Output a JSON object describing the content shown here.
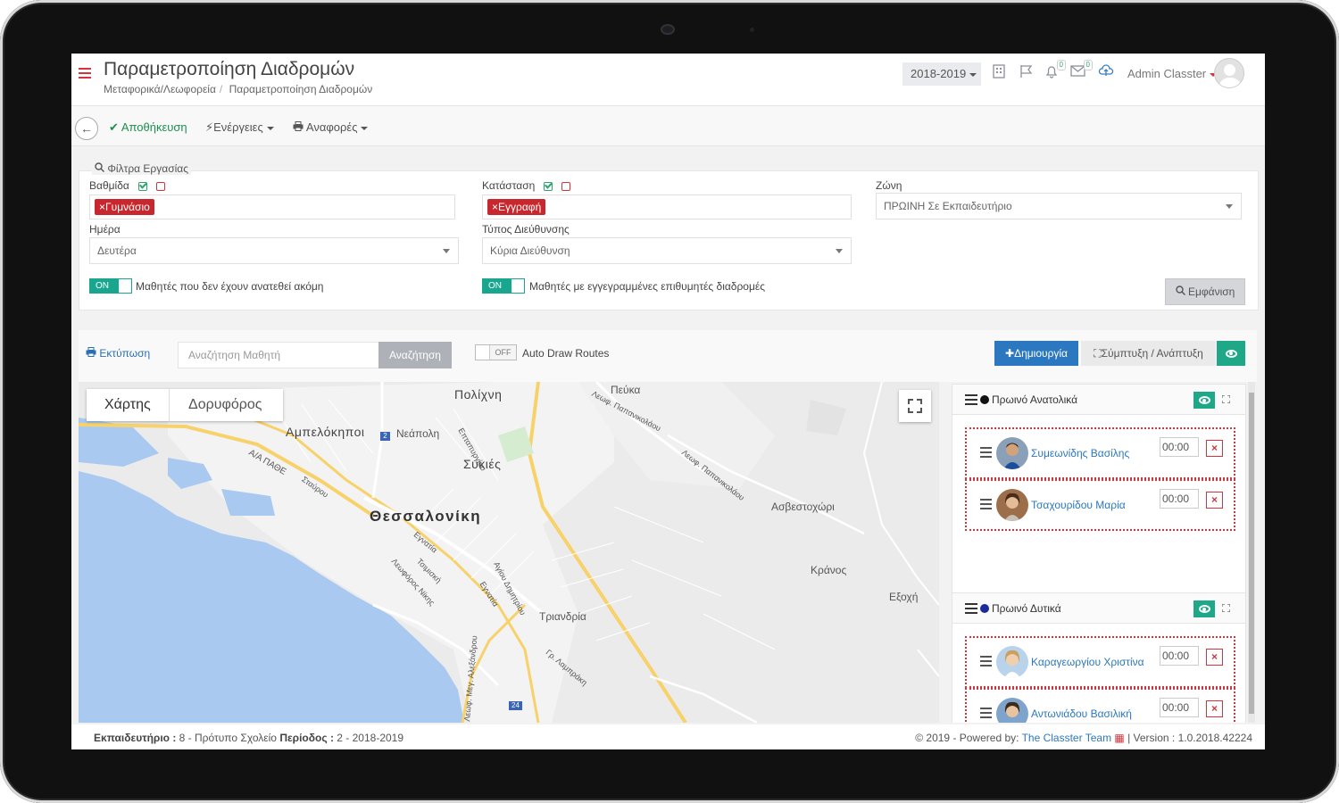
{
  "header": {
    "title": "Παραμετροποίηση Διαδρομών",
    "breadcrumb": [
      "Μεταφορικά/Λεωφορεία",
      "Παραμετροποίηση Διαδρομών"
    ],
    "year": "2018-2019",
    "notifications_count": "0",
    "messages_count": "0",
    "user": "Admin Classter"
  },
  "toolbar": {
    "save": "Αποθήκευση",
    "actions": "Ενέργειες",
    "reports": "Αναφορές"
  },
  "filters": {
    "title": "Φίλτρα Εργασίας",
    "grade_label": "Βαθμίδα",
    "grade_tag": "Γυμνάσιο",
    "status_label": "Κατάσταση",
    "status_tag": "Εγγραφή",
    "zone_label": "Ζώνη",
    "zone_value": "ΠΡΩΙΝΗ Σε Εκπαιδευτήριο",
    "day_label": "Ημέρα",
    "day_value": "Δευτέρα",
    "address_type_label": "Τύπος Διεύθυνσης",
    "address_type_value": "Κύρια Διεύθυνση",
    "toggle_on": "ON",
    "unassigned_label": "Μαθητές που δεν έχουν ανατεθεί ακόμη",
    "desired_routes_label": "Μαθητές με εγγεγραμμένες επιθυμητές διαδρομές",
    "show_button": "Εμφάνιση"
  },
  "main": {
    "print": "Εκτύπωση",
    "search_placeholder": "Αναζήτηση Μαθητή",
    "search_button": "Αναζήτηση",
    "auto_draw_toggle": "OFF",
    "auto_draw_label": "Auto Draw Routes",
    "create_button": "Δημιουργία",
    "collapse_button": "Σύμπτυξη / Ανάπτυξη"
  },
  "map": {
    "tab_map": "Χάρτης",
    "tab_satellite": "Δορυφόρος",
    "places": {
      "thessaloniki": "Θεσσαλονίκη",
      "polichni": "Πολίχνη",
      "ampelokipoi": "Αμπελόκηποι",
      "neapoli": "Νεάπολη",
      "sykies": "Συκιές",
      "pefka": "Πεύκα",
      "asvestochori": "Ασβεστοχώρι",
      "kranos": "Κράνος",
      "exochi": "Εξοχή",
      "triandria": "Τριανδρία"
    },
    "roads": {
      "papanikolaou": "Λεωφ. Παπανικολάου",
      "papanikolaou2": "Λεωφ. Παπανικολάου",
      "aa_papagou": "Α/Α ΠΑΘΕ",
      "stavrou": "Σταύρου",
      "egnatia": "Εγνατία",
      "egnatia2": "Εγνατία",
      "tsimiski": "Τσιμισκή",
      "leof_nikis": "Λεωφόρος Νίκης",
      "ag_dimitriou": "Αγίου Δημητρίου",
      "alexandrou": "Λεωφ. Μεγ. Αλεξάνδρου",
      "sheriff": "Επταπυργίου",
      "kalamaria": "Γρ. Λαμπράκη"
    },
    "road_markers": [
      "2",
      "24"
    ]
  },
  "routes": [
    {
      "name": "Πρωινό Ανατολικά",
      "color": "#111111",
      "students": [
        {
          "name": "Συμεωνίδης Βασίλης",
          "time": "00:00"
        },
        {
          "name": "Τσαχουρίδου Μαρία",
          "time": "00:00"
        }
      ]
    },
    {
      "name": "Πρωινό Δυτικά",
      "color": "#1a2a9a",
      "students": [
        {
          "name": "Καραγεωργίου Χριστίνα",
          "time": "00:00"
        },
        {
          "name": "Αντωνιάδου Βασιλική",
          "time": "00:00"
        }
      ]
    }
  ],
  "footer": {
    "school_label": "Εκπαιδευτήριο :",
    "school_value": "8 - Πρότυπο Σχολείο",
    "period_label": "Περίοδος :",
    "period_value": "2 - 2018-2019",
    "powered": "2019 - Powered by:",
    "team": "The Classter Team",
    "version": "| Version : 1.0.2018.42224"
  }
}
